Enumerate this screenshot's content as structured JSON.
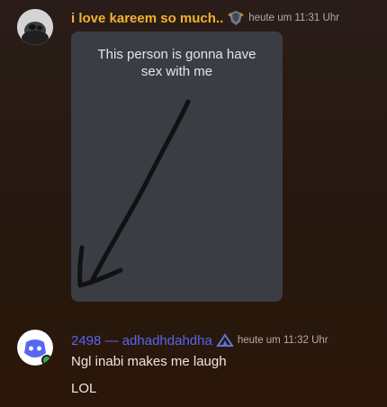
{
  "messages": [
    {
      "username": "i love kareem so much..",
      "username_color": "#f0b232",
      "timestamp": "heute um 11:31 Uhr",
      "image_caption_lines": [
        "This person is gonna have",
        "sex with me"
      ]
    },
    {
      "username": "2498 — adhadhdahdha",
      "username_color": "#5865f2",
      "timestamp": "heute um 11:32 Uhr",
      "lines": [
        "Ngl inabi makes me laugh",
        "LOL"
      ]
    }
  ],
  "icons": {
    "message1_role": "gem-role-icon",
    "message2_role": "mountain-role-icon",
    "message2_avatar": "discord-logo-avatar"
  }
}
